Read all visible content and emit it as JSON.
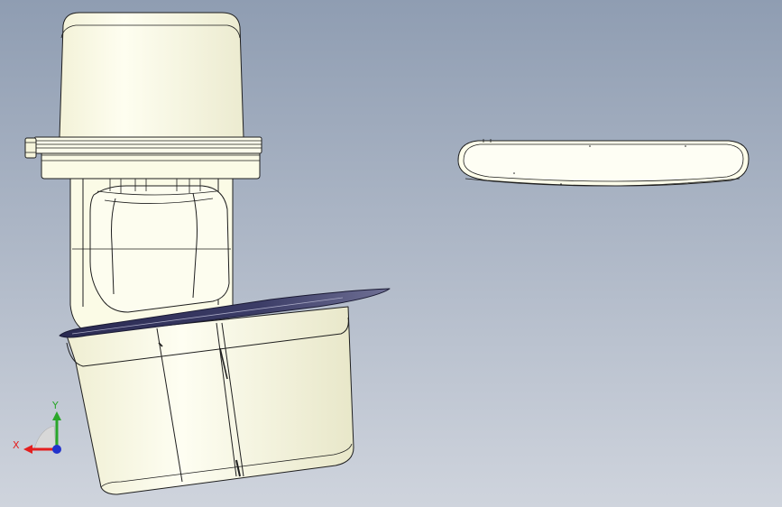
{
  "viewport": {
    "background_top": "#8f9db2",
    "background_bottom": "#cfd4dd"
  },
  "colors": {
    "part_fill": "#fdfde8",
    "part_edge": "#1e1e1e",
    "part_shade": "#ecebcf",
    "flange_fill": "#2b2b55",
    "flange_top": "#6f7095",
    "axis_x": "#e41f1f",
    "axis_y": "#2aa62a",
    "axis_z": "#2233cc",
    "axis_cone": "#d8d8d8"
  },
  "triad": {
    "x_label": "X",
    "y_label": "Y"
  },
  "models": {
    "left_assembly": "bottle-assembly",
    "right_part": "flat-lid"
  }
}
